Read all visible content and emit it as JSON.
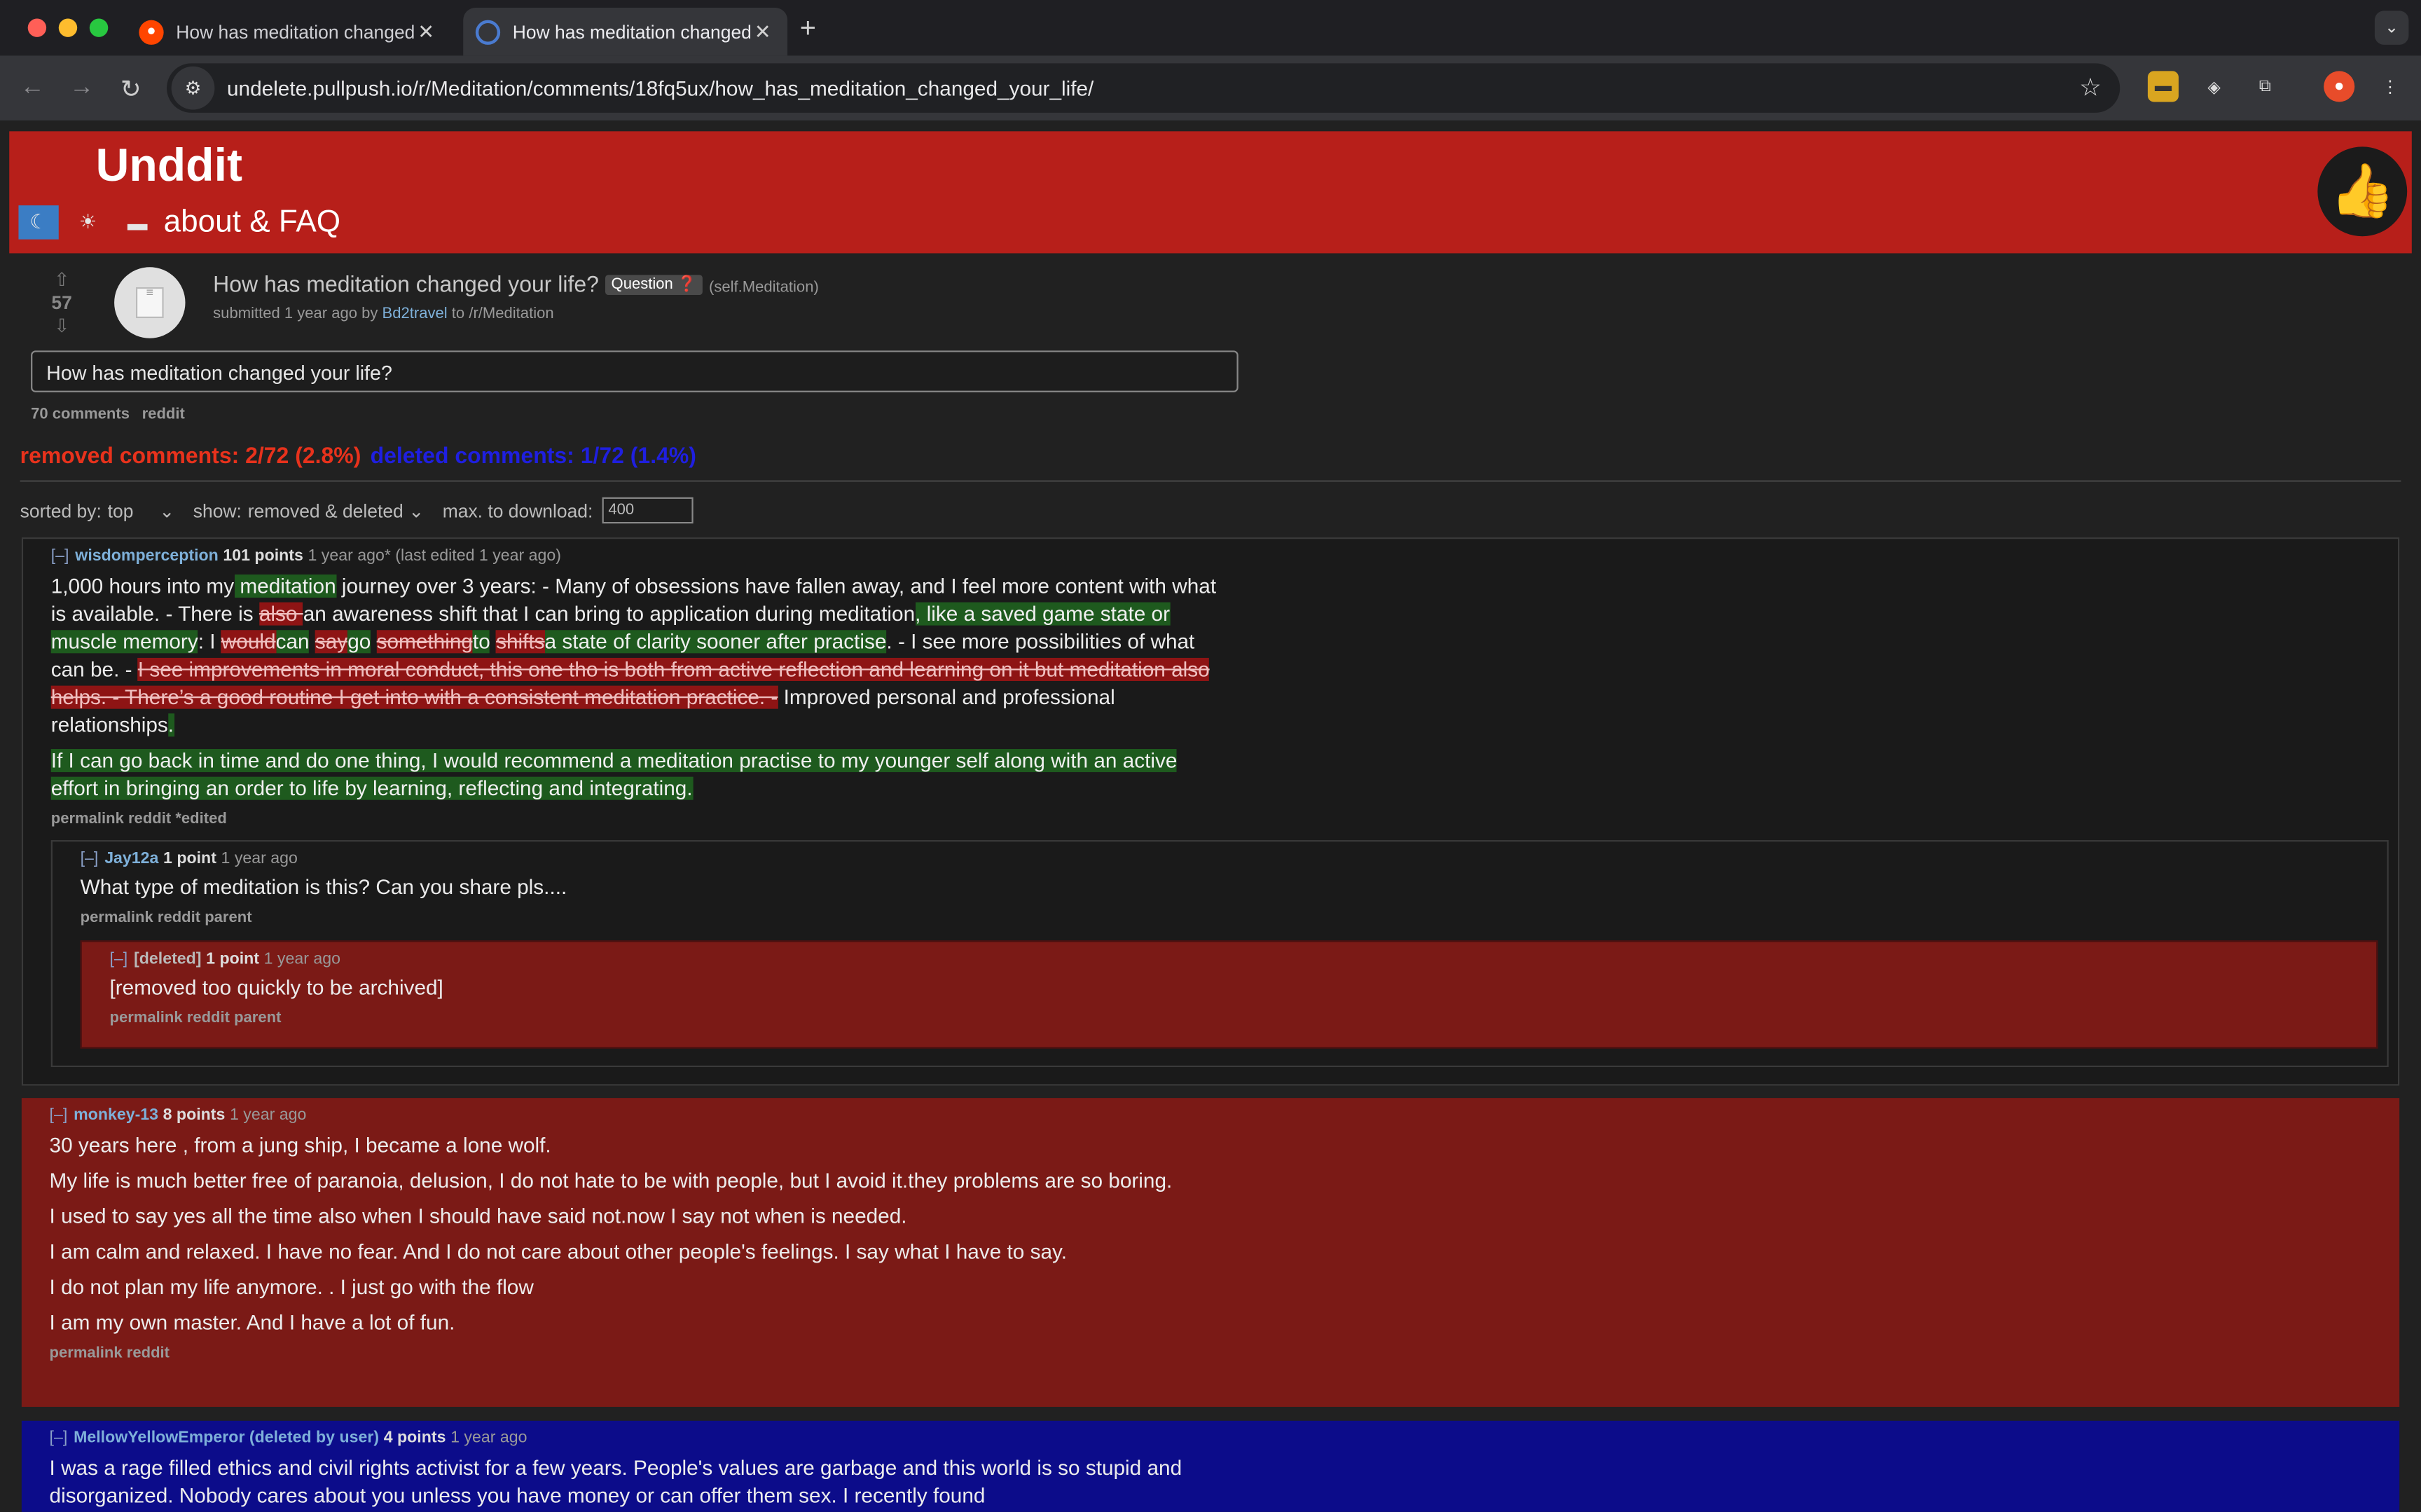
{
  "browser": {
    "tabs": [
      {
        "title": "How has meditation changed",
        "active": false
      },
      {
        "title": "How has meditation changed",
        "active": true
      }
    ],
    "new_tab": "+",
    "url": "undelete.pullpush.io/r/Meditation/comments/18fq5ux/how_has_meditation_changed_your_life/",
    "colors": {
      "tab_bar": "#1f1f23",
      "toolbar": "#35363a"
    }
  },
  "site": {
    "logo": "Unddit",
    "theme_icons": [
      "moon-icon",
      "sun-icon",
      "monitor-icon"
    ],
    "about_link": "about & FAQ",
    "header_color": "#b71f1a"
  },
  "post": {
    "score": "57",
    "title": "How has meditation changed your life?",
    "flair": "Question",
    "domain": "(self.Meditation)",
    "submitted_prefix": "submitted 1 year ago by",
    "author": "Bd2travel",
    "subreddit_prefix": "to",
    "subreddit": "/r/Meditation",
    "selftext": "How has meditation changed your life?",
    "comments_count": "70 comments",
    "reddit_link": "reddit"
  },
  "stats": {
    "removed": "removed comments: 2/72 (2.8%)",
    "deleted": "deleted comments: 1/72 (1.4%)"
  },
  "controls": {
    "sorted_label": "sorted by:",
    "sorted_value": "top",
    "show_label": "show:",
    "show_value": "removed & deleted",
    "max_label": "max. to download:",
    "max_value": "400"
  },
  "comments": [
    {
      "toggle": "[–]",
      "author": "wisdomperception",
      "points": "101 points",
      "time": "1 year ago* (last edited 1 year ago)",
      "links": "permalink reddit *edited"
    },
    {
      "toggle": "[–]",
      "author": "Jay12a",
      "points": "1 point",
      "time": "1 year ago",
      "body": "What type of meditation is this? Can you share pls....",
      "links": "permalink reddit parent"
    },
    {
      "toggle": "[–]",
      "author": "[deleted]",
      "points": "1 point",
      "time": "1 year ago",
      "body": "[removed too quickly to be archived]",
      "links": "permalink reddit parent"
    },
    {
      "toggle": "[–]",
      "author": "monkey-13",
      "points": "8 points",
      "time": "1 year ago",
      "paragraphs": [
        "30 years here , from a jung ship, I became a lone wolf.",
        "My life is much better free of paranoia, delusion, I do not hate to be with people, but I avoid it.they problems are so boring.",
        "I used to say yes all the time also when I should have said not.now I say not when is needed.",
        "I am calm and relaxed. I have no fear. And I do not care about other people's feelings. I say what I have to say.",
        "I do not plan my life anymore. . I just go with the flow",
        "I am my own master. And I have a lot of fun."
      ],
      "links": "permalink reddit"
    },
    {
      "toggle": "[–]",
      "author": "MellowYellowEmperor (deleted by user)",
      "points": "4 points",
      "time": "1 year ago",
      "body": "I was a rage filled ethics and civil rights activist for a few years. People's values are garbage and this world is so stupid and disorganized. Nobody cares about you unless you have money or can offer them sex. I recently found"
    }
  ],
  "diff": {
    "s1": "1,000 hours into my",
    "a1": " meditation",
    "s2": " journey over 3 years: - Many of obsessions have fallen away, and I feel more content with what is available. - There is ",
    "d1": "also ",
    "s3": "an awareness shift that I can bring to application during meditation",
    "a2": ", like a saved game state or muscle memory",
    "s4": ": I ",
    "d2": "would",
    "a3": "can",
    "s5": " ",
    "d3": "say",
    "a4": "go",
    "s6": " ",
    "d4": "something",
    "a5": "to",
    "s7": " ",
    "d5": "shifts",
    "a6": "a state of clarity sooner after practise",
    "s8": ". - I see more possibilities of what can be. - ",
    "d6": "I see improvements in moral conduct, this one tho is both from active reflection and learning on it but meditation also helps. - There’s a good routine I get into with a consistent meditation practice. -",
    "s9": " Improved personal and professional relationships",
    "a7": ".",
    "p2": "If I can go back in time and do one thing, I would recommend a meditation practise to my younger self along with an active effort in bringing an order to life by learning, reflecting and integrating."
  },
  "colors": {
    "page_bg": "#212121",
    "removed_bg": "#7b1a16",
    "deleted_bg": "#0c0c8a",
    "added_highlight": "#1e5a1e",
    "removed_highlight": "#8e1414",
    "removed_text": "#e8321c",
    "deleted_text": "#1f1fe0"
  }
}
